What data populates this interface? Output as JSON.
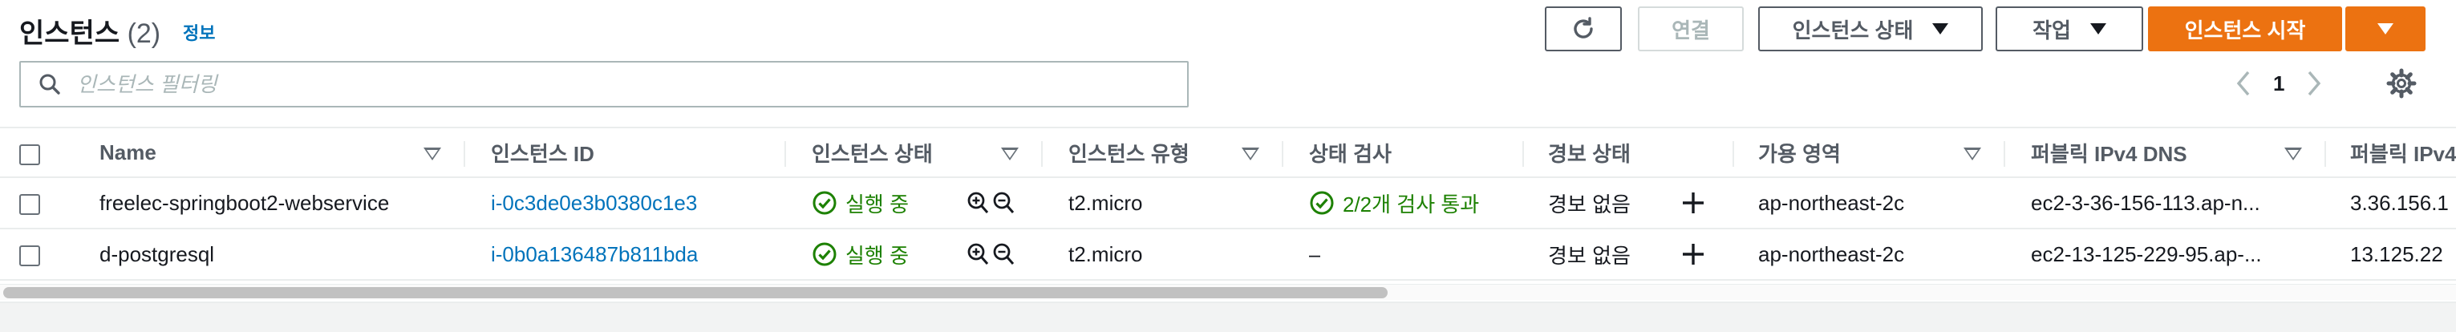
{
  "header": {
    "title": "인스턴스",
    "count": "(2)",
    "info_link": "정보"
  },
  "toolbar": {
    "refresh_icon": "refresh-icon",
    "connect_label": "연결",
    "instance_state_label": "인스턴스 상태",
    "actions_label": "작업",
    "launch_label": "인스턴스 시작"
  },
  "filter": {
    "placeholder": "인스턴스 필터링",
    "value": ""
  },
  "pagination": {
    "current_page": "1"
  },
  "columns": [
    {
      "label": "Name"
    },
    {
      "label": "인스턴스 ID"
    },
    {
      "label": "인스턴스 상태"
    },
    {
      "label": "인스턴스 유형"
    },
    {
      "label": "상태 검사"
    },
    {
      "label": "경보 상태"
    },
    {
      "label": "가용 영역"
    },
    {
      "label": "퍼블릭 IPv4 DNS"
    },
    {
      "label": "퍼블릭 IPv4"
    }
  ],
  "rows": [
    {
      "name": "freelec-springboot2-webservice",
      "instance_id": "i-0c3de0e3b0380c1e3",
      "state": "실행 중",
      "type": "t2.micro",
      "status_check": "2/2개 검사 통과",
      "alarm": "경보 없음",
      "az": "ap-northeast-2c",
      "dns": "ec2-3-36-156-113.ap-n...",
      "ipv4": "3.36.156.1"
    },
    {
      "name": "d-postgresql",
      "instance_id": "i-0b0a136487b811bda",
      "state": "실행 중",
      "type": "t2.micro",
      "status_check": "–",
      "alarm": "경보 없음",
      "az": "ap-northeast-2c",
      "dns": "ec2-13-125-229-95.ap-...",
      "ipv4": "13.125.22"
    }
  ],
  "colors": {
    "link": "#0073bb",
    "primary": "#ec7211",
    "success": "#1d8102"
  }
}
